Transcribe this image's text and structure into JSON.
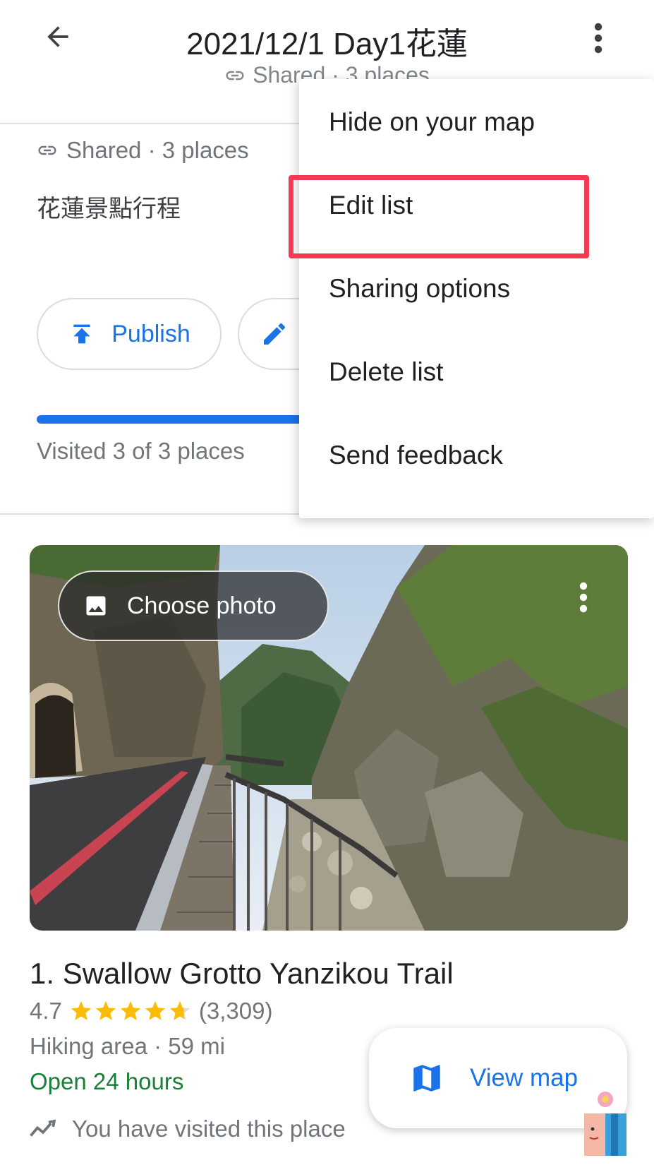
{
  "appbar": {
    "title": "2021/12/1 Day1花蓮",
    "subtitle": "Shared · 3 places"
  },
  "list": {
    "shared_line": "Shared · 3 places",
    "description": "花蓮景點行程",
    "publish_label": "Publish",
    "visited_text": "Visited 3 of 3 places",
    "visited_progress": 1.0
  },
  "menu": {
    "items": [
      {
        "label": "Hide on your map"
      },
      {
        "label": "Edit list"
      },
      {
        "label": "Sharing options"
      },
      {
        "label": "Delete list"
      },
      {
        "label": "Send feedback"
      }
    ],
    "highlighted_item": "Edit list",
    "highlight_color": "#f23a55"
  },
  "card": {
    "choose_photo_label": "Choose photo",
    "place_name": "1. Swallow Grotto Yanzikou Trail",
    "rating": "4.7",
    "rating_stars": 4.7,
    "review_count": "(3,309)",
    "category_distance": "Hiking area · 59 mi",
    "hours": "Open 24 hours",
    "visited_note": "You have visited this place"
  },
  "fab": {
    "view_map_label": "View map"
  },
  "colors": {
    "accent": "#1a73e8",
    "open_green": "#188038",
    "star": "#fbbc04",
    "secondary_text": "#70757a"
  }
}
